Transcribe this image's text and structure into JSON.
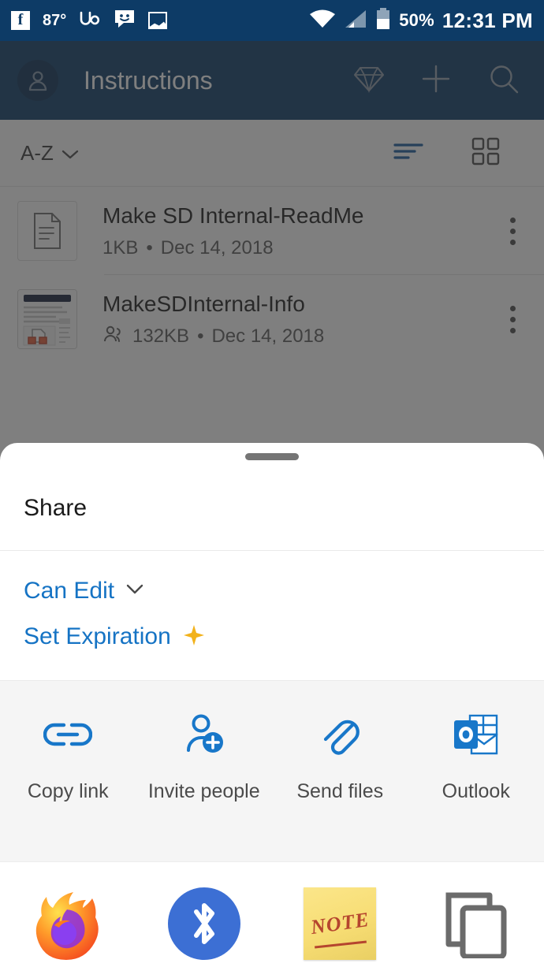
{
  "statusbar": {
    "left_icons": [
      "facebook-icon",
      "upwork-icon",
      "messages-smiley-icon",
      "screenshot-image-icon"
    ],
    "temperature": "87°",
    "upwork_label": "up",
    "wifi_icon": "wifi-full-icon",
    "cellular_icon": "cellular-signal-icon",
    "battery_icon": "battery-half-icon",
    "battery_percent": "50%",
    "time": "12:31 PM"
  },
  "appbar": {
    "avatar": "account-avatar",
    "title": "Instructions",
    "actions": [
      "premium-diamond-icon",
      "add-plus-icon",
      "search-icon"
    ]
  },
  "sortbar": {
    "sort_label": "A-Z",
    "sort_chevron": "chevron-down-icon",
    "list_view_icon": "list-view-icon",
    "grid_view_icon": "grid-view-icon"
  },
  "files": [
    {
      "name": "Make SD Internal-ReadMe",
      "size": "1KB",
      "separator": "•",
      "date": "Dec 14, 2018",
      "shared": false,
      "thumb": "document-icon",
      "menu": "overflow-menu-icon"
    },
    {
      "name": "MakeSDInternal-Info",
      "size": "132KB",
      "separator": "•",
      "date": "Dec 14, 2018",
      "shared": true,
      "shared_icon": "people-shared-icon",
      "thumb": "document-preview-thumbnail",
      "menu": "overflow-menu-icon"
    }
  ],
  "share_sheet": {
    "drag_handle": "drag-handle",
    "title": "Share",
    "permission": {
      "label": "Can Edit",
      "chevron": "chevron-down-icon"
    },
    "expiration": {
      "label": "Set Expiration",
      "badge_icon": "premium-sparkle-icon"
    },
    "actions": [
      {
        "label": "Copy link",
        "icon": "link-icon"
      },
      {
        "label": "Invite people",
        "icon": "add-person-icon"
      },
      {
        "label": "Send files",
        "icon": "paperclip-icon"
      },
      {
        "label": "Outlook",
        "icon": "outlook-icon"
      }
    ],
    "apps": [
      {
        "icon": "firefox-icon"
      },
      {
        "icon": "bluetooth-icon"
      },
      {
        "icon": "note-icon",
        "label": "NOTE"
      },
      {
        "icon": "copy-to-clipboard-icon"
      }
    ]
  },
  "colors": {
    "appbar": "#0d3b66",
    "accent_blue": "#1573c4",
    "premium_gold": "#f2b21b",
    "scrim": "rgba(48,48,48,0.62)",
    "actions_bg": "#f5f5f5"
  }
}
